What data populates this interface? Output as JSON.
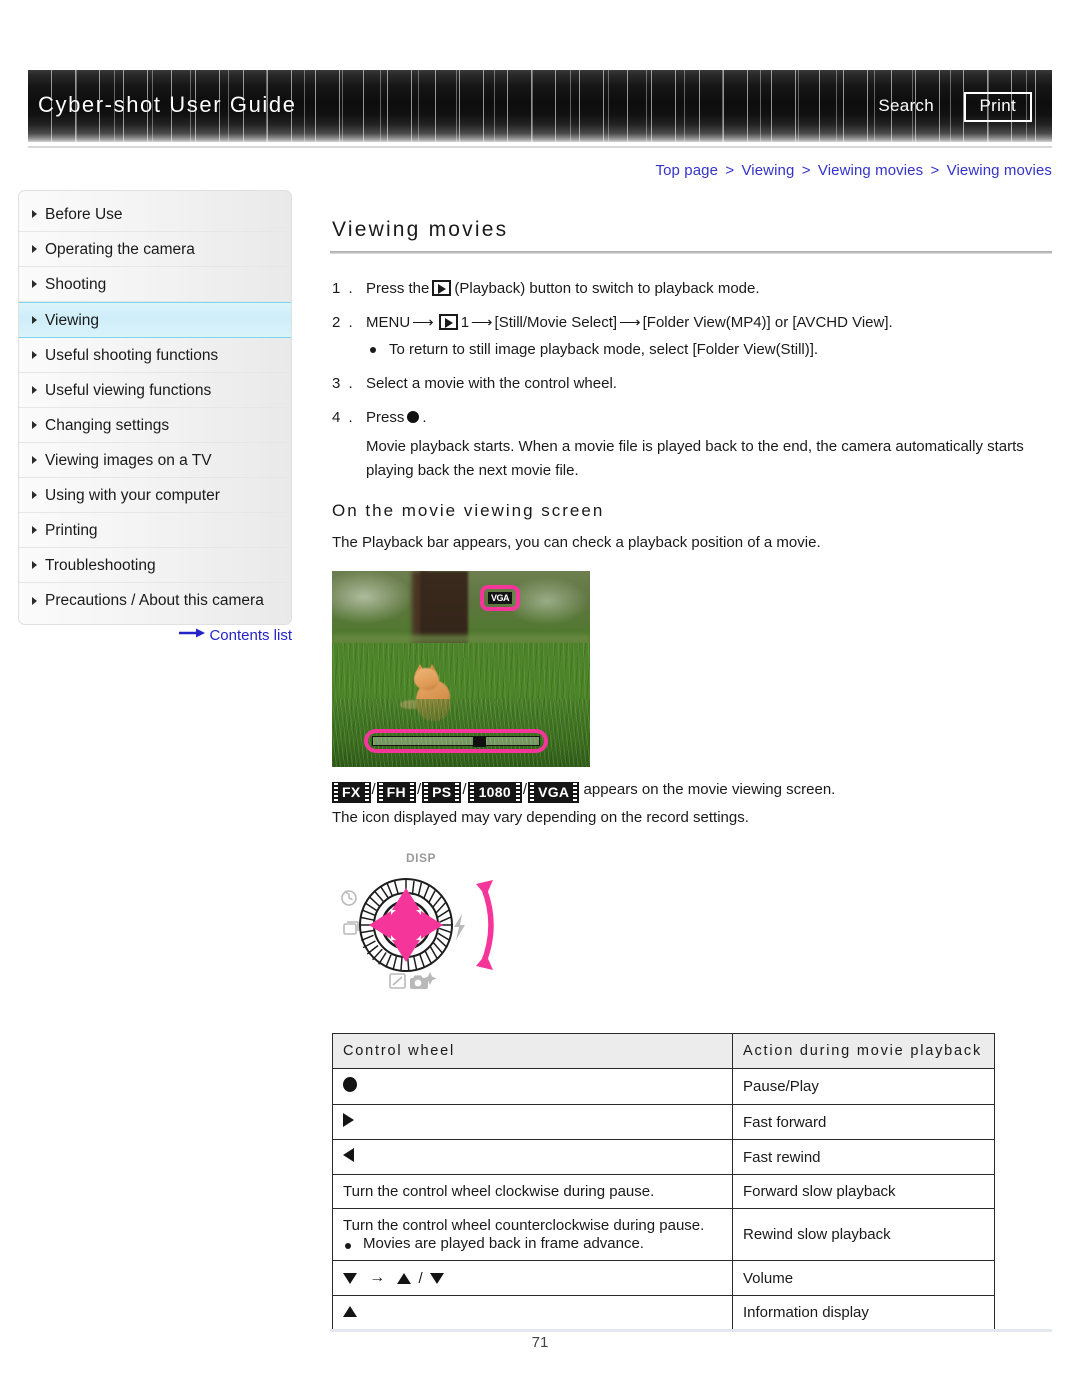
{
  "header": {
    "title": "Cyber-shot User Guide",
    "search_label": "Search",
    "print_label": "Print"
  },
  "breadcrumb": {
    "items": [
      "Top page",
      "Viewing",
      "Viewing movies",
      "Viewing movies"
    ],
    "separator": ">",
    "color": "#3333cc"
  },
  "sidebar": {
    "items": [
      {
        "label": "Before Use",
        "selected": false
      },
      {
        "label": "Operating the camera",
        "selected": false
      },
      {
        "label": "Shooting",
        "selected": false
      },
      {
        "label": "Viewing",
        "selected": true
      },
      {
        "label": "Useful shooting functions",
        "selected": false
      },
      {
        "label": "Useful viewing functions",
        "selected": false
      },
      {
        "label": "Changing settings",
        "selected": false
      },
      {
        "label": "Viewing images on a TV",
        "selected": false
      },
      {
        "label": "Using with your computer",
        "selected": false
      },
      {
        "label": "Printing",
        "selected": false
      },
      {
        "label": "Troubleshooting",
        "selected": false
      },
      {
        "label": "Precautions / About this camera",
        "selected": false
      }
    ],
    "contents_list_label": "Contents list",
    "selected_accent": "#7fd4ee"
  },
  "main": {
    "page_title": "Viewing movies",
    "steps": [
      {
        "num": "1 .",
        "text_before": "Press the",
        "text_after": "(Playback) button to switch to playback mode."
      },
      {
        "num": "2 .",
        "text_before": "MENU",
        "text_mid": "1",
        "text_after": "[Still/Movie Select]",
        "text_end": "[Folder View(MP4)] or [AVCHD View].",
        "substep": "To return to still image playback mode, select [Folder View(Still)]."
      },
      {
        "num": "3 .",
        "text_full": "Select a movie with the control wheel."
      },
      {
        "num": "4 .",
        "text_before": "Press",
        "text_after": ".",
        "description": "Movie playback starts. When a movie file is played back to the end, the camera automatically starts playing back the next movie file."
      }
    ],
    "subhead": "On the movie viewing screen",
    "subhead_body": "The Playback bar appears, you can check a playback position of a movie.",
    "screen_photo": {
      "badge_label": "VGA",
      "highlight_color": "#f5359a"
    },
    "codec_badges": [
      "FX",
      "FH",
      "PS",
      "1080",
      "VGA"
    ],
    "codec_separator": "/",
    "codec_line_text": "appears on the movie viewing screen.",
    "codec_line_text2": "The icon displayed may vary depending on the record settings.",
    "wheel": {
      "disp_label": "DISP",
      "accent": "#f5359a"
    }
  },
  "table": {
    "headers": [
      "Control wheel",
      "Action during movie playback"
    ],
    "rows": [
      {
        "glyph": "circle",
        "control": "",
        "action": "Pause/Play"
      },
      {
        "glyph": "right",
        "control": "",
        "action": "Fast forward"
      },
      {
        "glyph": "left",
        "control": "",
        "action": "Fast rewind"
      },
      {
        "glyph": "none",
        "control": "Turn the control wheel clockwise during pause.",
        "action": "Forward slow playback"
      },
      {
        "glyph": "none",
        "control": "Turn the control wheel counterclockwise during pause.",
        "control_sub": "Movies are played back in frame advance.",
        "action": "Rewind slow playback"
      },
      {
        "glyph": "volume",
        "control": "",
        "action": "Volume"
      },
      {
        "glyph": "up",
        "control": "",
        "action": "Information display"
      }
    ]
  },
  "footer": {
    "page_number": "71"
  }
}
